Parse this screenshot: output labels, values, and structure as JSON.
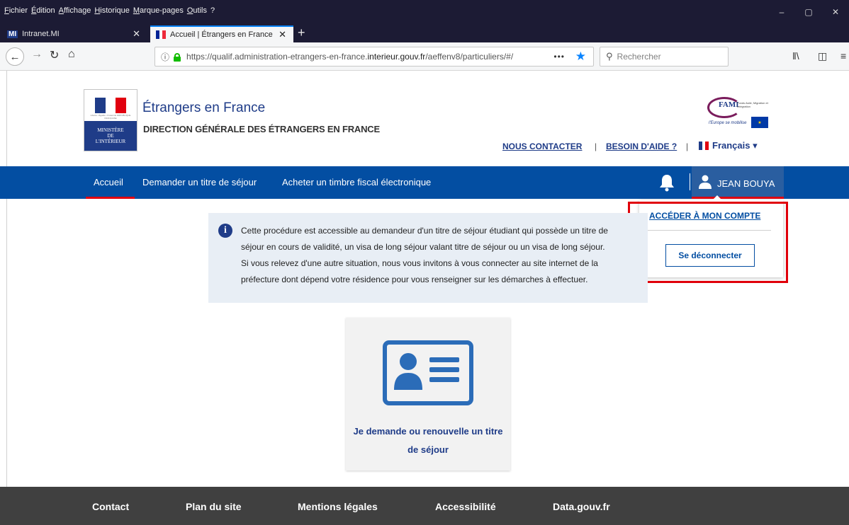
{
  "browser": {
    "menu": [
      "Fichier",
      "Édition",
      "Affichage",
      "Historique",
      "Marque-pages",
      "Outils",
      "?"
    ],
    "window_controls": [
      "–",
      "▢",
      "✕"
    ],
    "tabs": [
      {
        "label": "Intranet.MI",
        "favicon": "MI"
      },
      {
        "label": "Accueil | Étrangers en France"
      }
    ],
    "tab_close": "✕",
    "new_tab": "+",
    "url_prefix": "https://qualif.administration-etrangers-en-france.",
    "url_domain": "interieur.gouv.fr",
    "url_suffix": "/aeffenv8/particuliers/#/",
    "url_dots": "•••",
    "search_placeholder": "Rechercher"
  },
  "logo": {
    "motto": "Liberté • Égalité • Fraternité RÉPUBLIQUE FRANÇAISE",
    "line1": "MINISTÈRE",
    "line2": "DE",
    "line3": "L'INTÉRIEUR"
  },
  "header": {
    "title": "Étrangers en France",
    "subtitle": "DIRECTION GÉNÉRALE DES ÉTRANGERS EN FRANCE",
    "contact": "NOUS CONTACTER",
    "help": "BESOIN D'AIDE ?",
    "sep": "|",
    "language": "Français ▾"
  },
  "fami": {
    "name": "FAMI",
    "small": "Fonds Asile, Migration et Intégration",
    "tagline": "l'Europe se mobilise"
  },
  "nav": {
    "items": [
      "Accueil",
      "Demander un titre de séjour",
      "Acheter un timbre fiscal électronique"
    ],
    "user": "JEAN BOUYA"
  },
  "dropdown": {
    "account": "ACCÉDER À MON COMPTE",
    "logout": "Se déconnecter"
  },
  "info": {
    "lines": [
      "Cette procédure est accessible au demandeur d'un titre de séjour étudiant qui possède un titre de",
      "séjour en cours de validité, un visa de long séjour valant titre de séjour ou un visa de long séjour.",
      "Si vous relevez d'une autre situation, nous vous invitons à vous connecter au site internet de la",
      "préfecture dont dépend votre résidence pour vous renseigner sur les démarches à effectuer."
    ]
  },
  "card": {
    "line1": "Je demande ou renouvelle un titre",
    "line2": "de séjour"
  },
  "footer": {
    "links": [
      "Contact",
      "Plan du site",
      "Mentions légales",
      "Accessibilité",
      "Data.gouv.fr"
    ]
  },
  "colors": {
    "nav_blue": "#034ea2",
    "brand_blue": "#1f3c88",
    "accent_red": "#e1000f",
    "footer": "#404040"
  }
}
